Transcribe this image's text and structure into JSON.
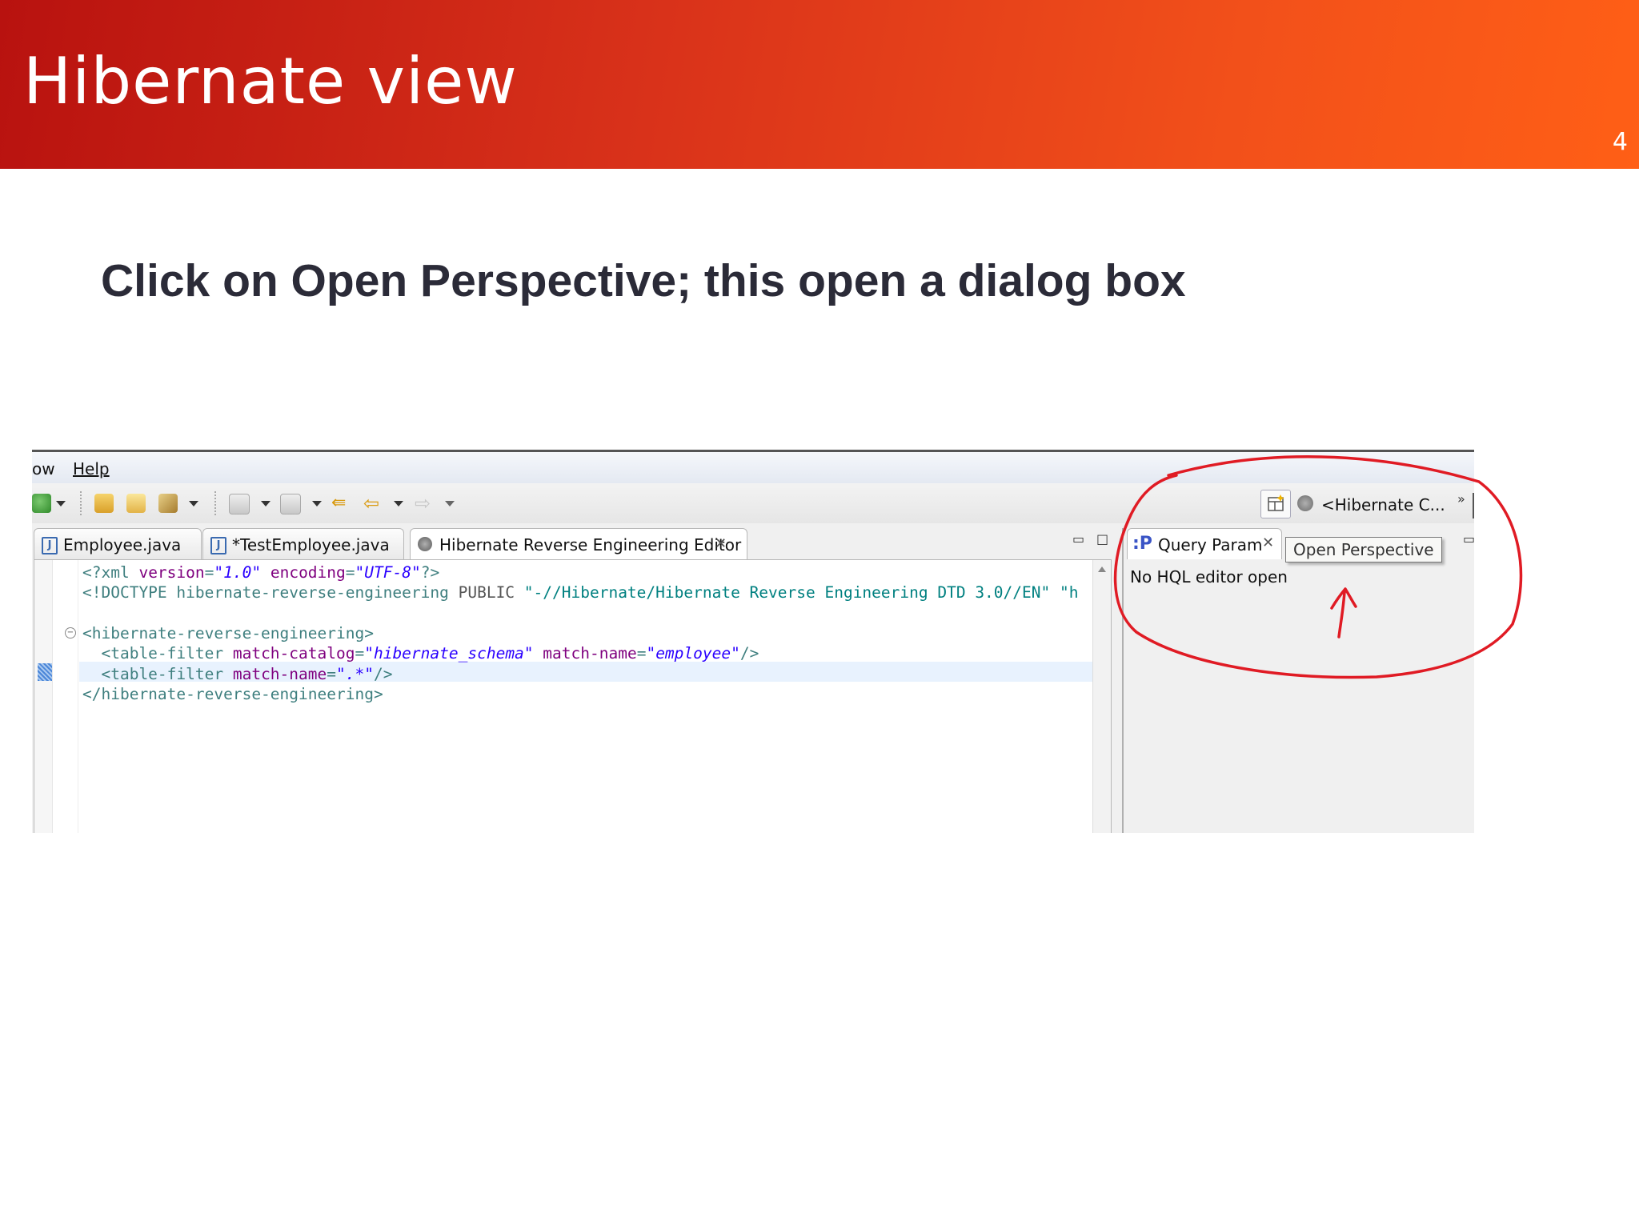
{
  "slide": {
    "title": "Hibernate view",
    "page_number": "4",
    "subtitle": "Click  on Open Perspective; this open a dialog box",
    "colors": {
      "banner_start": "#b8120f",
      "banner_end": "#ff5f16",
      "annotation": "#e01b24"
    }
  },
  "screenshot": {
    "menu": {
      "window_partial": "ow",
      "help": "Help"
    },
    "toolbar": {
      "icons": [
        "run-icon",
        "open-type-icon",
        "open-folder-icon",
        "pin-icon",
        "prev-annotation-icon",
        "next-annotation-icon",
        "last-edit-icon",
        "back-icon",
        "forward-icon"
      ]
    },
    "perspective_switcher": {
      "hibernate_label": "<Hibernate C...",
      "overflow": "»"
    },
    "editor_tabs": [
      {
        "label": "Employee.java",
        "icon": "java-file-icon"
      },
      {
        "label": "*TestEmployee.java",
        "icon": "java-file-icon"
      },
      {
        "label": "Hibernate Reverse Engineering Editor",
        "icon": "hibernate-icon",
        "active": true
      }
    ],
    "editor": {
      "lines": [
        {
          "parts": [
            [
              "c-tag",
              "<?xml "
            ],
            [
              "c-attr",
              "version"
            ],
            [
              "c-tag",
              "="
            ],
            [
              "c-str",
              "\"1.0\""
            ],
            [
              "c-tag",
              " "
            ],
            [
              "c-attr",
              "encoding"
            ],
            [
              "c-tag",
              "="
            ],
            [
              "c-str",
              "\"UTF-8\""
            ],
            [
              "c-tag",
              "?>"
            ]
          ]
        },
        {
          "parts": [
            [
              "c-dt",
              "<!DOCTYPE hibernate-reverse-engineering "
            ],
            [
              "c-pub",
              "PUBLIC "
            ],
            [
              "c-str2",
              "\"-//Hibernate/Hibernate Reverse Engineering DTD 3.0//EN\" \"h"
            ]
          ]
        },
        {
          "parts": []
        },
        {
          "parts": [
            [
              "c-tag",
              "<hibernate-reverse-engineering>"
            ]
          ]
        },
        {
          "parts": [
            [
              "c-tag",
              "  <table-filter "
            ],
            [
              "c-attr",
              "match-catalog"
            ],
            [
              "c-tag",
              "="
            ],
            [
              "c-str",
              "\"hibernate_schema\""
            ],
            [
              "c-tag",
              " "
            ],
            [
              "c-attr",
              "match-name"
            ],
            [
              "c-tag",
              "="
            ],
            [
              "c-str",
              "\"employee\""
            ],
            [
              "c-tag",
              "/>"
            ]
          ]
        },
        {
          "parts": [
            [
              "c-tag",
              "  <table-filter "
            ],
            [
              "c-attr",
              "match-name"
            ],
            [
              "c-tag",
              "="
            ],
            [
              "c-str",
              "\".*\""
            ],
            [
              "c-tag",
              "/>"
            ]
          ]
        },
        {
          "parts": [
            [
              "c-tag",
              "</hibernate-reverse-engineering>"
            ]
          ]
        }
      ]
    },
    "query_panel": {
      "tab_label": "Query Param",
      "tooltip": "Open Perspective",
      "message": "No HQL editor open"
    }
  }
}
